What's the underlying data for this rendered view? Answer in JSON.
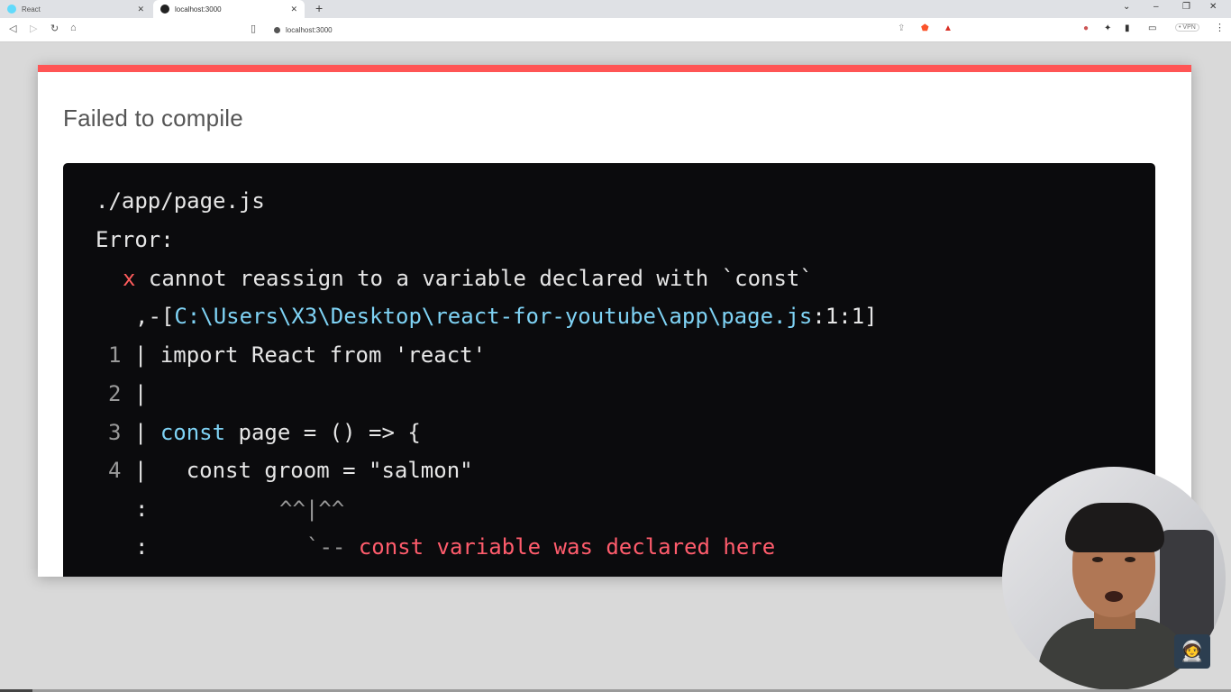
{
  "browser": {
    "tabs": [
      {
        "title": "React",
        "active": false
      },
      {
        "title": "localhost:3000",
        "active": true
      }
    ],
    "new_tab_symbol": "+",
    "window_controls": [
      "⌄",
      "–",
      "❐",
      "✕"
    ],
    "url": "localhost:3000",
    "vpn_label": "• VPN"
  },
  "error_overlay": {
    "accent_color": "#ff5555",
    "title": "Failed to compile",
    "file": "./app/page.js",
    "error_label": "Error:",
    "error_marker": "x",
    "message": "cannot reassign to a variable declared with `const`",
    "location_prefix": ",-[",
    "location_path": "C:\\Users\\X3\\Desktop\\react-for-youtube\\app\\page.js",
    "location_suffix": ":1:1]",
    "code_lines": [
      {
        "num": "1",
        "pipe": "|",
        "pre": "import React from 'react'",
        "kw": ""
      },
      {
        "num": "2",
        "pipe": "|",
        "pre": "",
        "kw": ""
      },
      {
        "num": "3",
        "pipe": "|",
        "kw": "const",
        "pre": " page = () => {"
      },
      {
        "num": "4",
        "pipe": "|",
        "pre": "  const groom = \"salmon\"",
        "kw": ""
      }
    ],
    "carets": "^^|^^",
    "annotation_prefix": "`--",
    "annotation": "const variable was declared here",
    "gutter_dots": ":"
  },
  "webcam": {
    "mascot_icon": "🧑‍🚀"
  }
}
